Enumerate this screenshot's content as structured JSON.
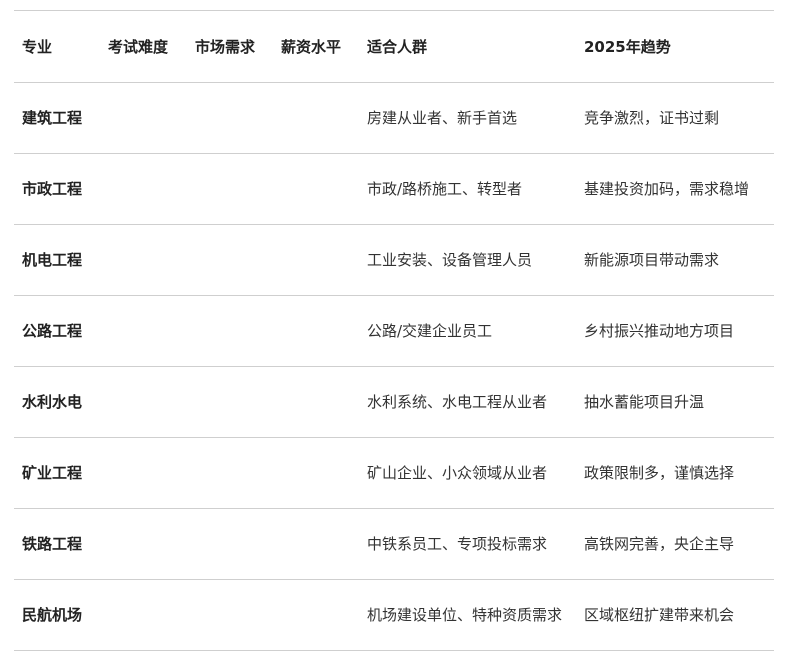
{
  "table": {
    "headers": [
      "专业",
      "考试难度",
      "市场需求",
      "薪资水平",
      "适合人群",
      "2025年趋势"
    ],
    "rows": [
      [
        "建筑工程",
        "",
        "",
        "",
        "房建从业者、新手首选",
        "竞争激烈，证书过剩"
      ],
      [
        "市政工程",
        "",
        "",
        "",
        "市政/路桥施工、转型者",
        "基建投资加码，需求稳增"
      ],
      [
        "机电工程",
        "",
        "",
        "",
        "工业安装、设备管理人员",
        "新能源项目带动需求"
      ],
      [
        "公路工程",
        "",
        "",
        "",
        "公路/交建企业员工",
        "乡村振兴推动地方项目"
      ],
      [
        "水利水电",
        "",
        "",
        "",
        "水利系统、水电工程从业者",
        "抽水蓄能项目升温"
      ],
      [
        "矿业工程",
        "",
        "",
        "",
        "矿山企业、小众领域从业者",
        "政策限制多，谨慎选择"
      ],
      [
        "铁路工程",
        "",
        "",
        "",
        "中铁系员工、专项投标需求",
        "高铁网完善，央企主导"
      ],
      [
        "民航机场",
        "",
        "",
        "",
        "机场建设单位、特种资质需求",
        "区域枢纽扩建带来机会"
      ]
    ]
  }
}
